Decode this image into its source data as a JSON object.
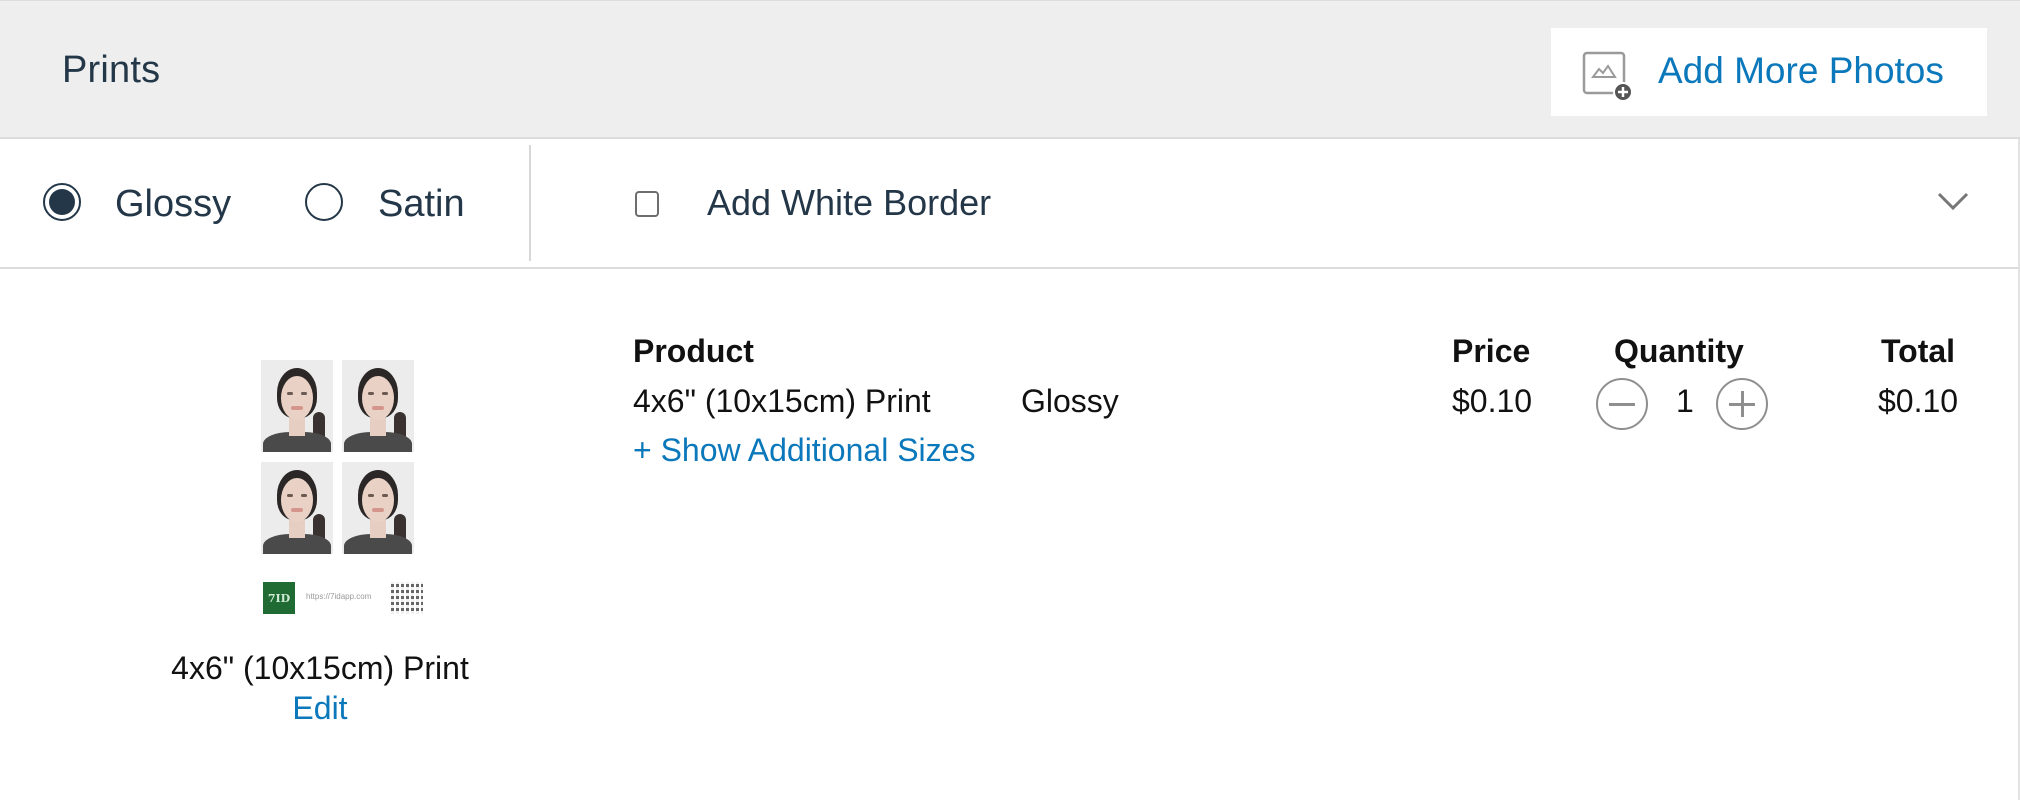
{
  "header": {
    "title": "Prints",
    "add_photos_label": "Add More Photos",
    "add_photos_icon": "add-photo-icon"
  },
  "options": {
    "finish": {
      "items": [
        {
          "label": "Glossy",
          "checked": true
        },
        {
          "label": "Satin",
          "checked": false
        }
      ]
    },
    "white_border": {
      "label": "Add White Border",
      "checked": false
    },
    "expand_icon": "chevron-down-icon"
  },
  "thumbnail": {
    "brand_mark": "7ID",
    "brand_url": "https://7idapp.com",
    "caption": "4x6\" (10x15cm) Print",
    "edit_label": "Edit"
  },
  "table": {
    "headers": {
      "product": "Product",
      "price": "Price",
      "quantity": "Quantity",
      "total": "Total"
    },
    "row": {
      "product": "4x6\" (10x15cm) Print",
      "finish": "Glossy",
      "price": "$0.10",
      "quantity": "1",
      "total": "$0.10"
    },
    "show_sizes_label": "+ Show Additional Sizes"
  },
  "colors": {
    "link": "#0b78bb",
    "text_dark": "#233748",
    "header_bg": "#eeeeee"
  }
}
